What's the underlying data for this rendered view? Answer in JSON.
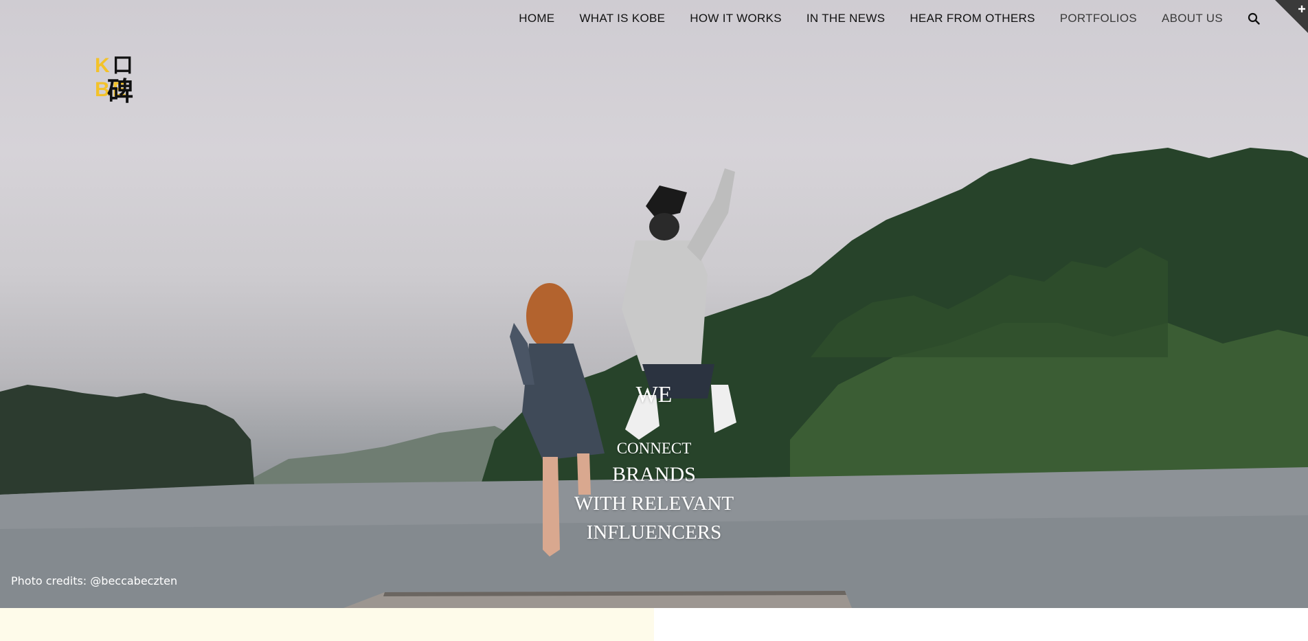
{
  "nav": {
    "items": [
      "HOME",
      "WHAT IS KOBE",
      "HOW IT WORKS",
      "IN THE NEWS",
      "HEAR FROM OTHERS",
      "PORTFOLIOS",
      "ABOUT US"
    ]
  },
  "logo": {
    "word_k": "K",
    "word_box": "口",
    "word_be": "BE",
    "han": "碑"
  },
  "hero": {
    "line1": "WE",
    "line2": "CONNECT",
    "line3": "BRANDS",
    "line4": "WITH RELEVANT",
    "line5": "INFLUENCERS",
    "credits": "Photo credits: @beccabeczten"
  },
  "colors": {
    "logo_yellow": "#f3c22a",
    "band": "#fefbea",
    "corner": "#3a3a3a"
  }
}
